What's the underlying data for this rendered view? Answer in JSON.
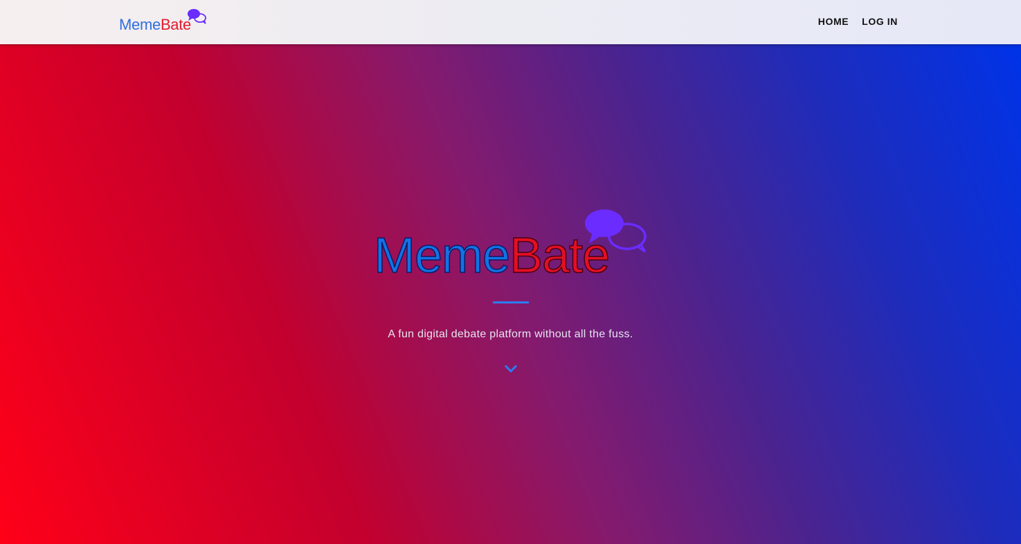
{
  "header": {
    "logo": {
      "part1": "Meme",
      "part2": "Bate"
    },
    "nav": [
      {
        "label": "HOME"
      },
      {
        "label": "LOG IN"
      }
    ]
  },
  "hero": {
    "logo": {
      "part1": "Meme",
      "part2": "Bate"
    },
    "tagline": "A fun digital debate platform without all the fuss.",
    "scroll_icon": "chevron-down-icon"
  },
  "colors": {
    "logo_blue": "#2f6fe0",
    "logo_red": "#e51b2f",
    "bubble_purple": "#6a2cff",
    "divider_blue": "#2a7df0",
    "gradient_left": "#ff0018",
    "gradient_right": "#0033e8"
  }
}
